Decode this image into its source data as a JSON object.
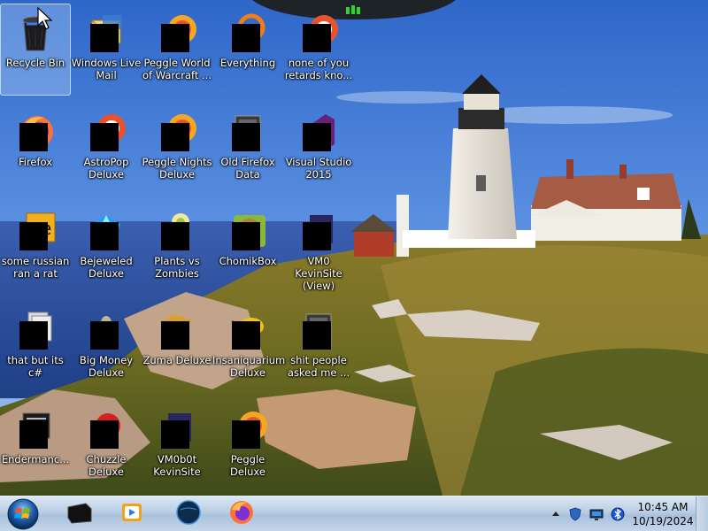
{
  "desktop": {
    "icons": [
      {
        "label": "Recycle Bin",
        "icon": "recycle-bin-icon",
        "redacted": false,
        "selected": true
      },
      {
        "label": "Windows Live Mail",
        "icon": "mail-icon",
        "redacted": true
      },
      {
        "label": "Peggle World of Warcraft ...",
        "icon": "peggle-icon",
        "redacted": true
      },
      {
        "label": "Everything",
        "icon": "search-icon",
        "redacted": true
      },
      {
        "label": "none of you retards kno...",
        "icon": "game-icon",
        "redacted": true
      },
      {
        "label": "Firefox",
        "icon": "firefox-icon",
        "redacted": true
      },
      {
        "label": "AstroPop Deluxe",
        "icon": "game-icon",
        "redacted": true
      },
      {
        "label": "Peggle Nights Deluxe",
        "icon": "peggle-icon",
        "redacted": true
      },
      {
        "label": "Old Firefox Data",
        "icon": "folder-icon",
        "redacted": true
      },
      {
        "label": "Visual Studio 2015",
        "icon": "visual-studio-icon",
        "redacted": true
      },
      {
        "label": "some russian ran a rat",
        "icon": "file-icon",
        "redacted": true
      },
      {
        "label": "Bejeweled Deluxe",
        "icon": "gem-icon",
        "redacted": true
      },
      {
        "label": "Plants vs Zombies",
        "icon": "plant-icon",
        "redacted": true
      },
      {
        "label": "ChomikBox",
        "icon": "hamster-icon",
        "redacted": true
      },
      {
        "label": "VM0 KevinSite (View)",
        "icon": "shortcut-icon",
        "redacted": true
      },
      {
        "label": "that but its c#",
        "icon": "document-icon",
        "redacted": true
      },
      {
        "label": "Big Money Deluxe",
        "icon": "money-icon",
        "redacted": true
      },
      {
        "label": "Zuma Deluxe",
        "icon": "frog-icon",
        "redacted": true
      },
      {
        "label": "Insaniquarium Deluxe",
        "icon": "fish-icon",
        "redacted": true
      },
      {
        "label": "shit people asked me ...",
        "icon": "folder-icon",
        "redacted": true
      },
      {
        "label": "Endermanc...",
        "icon": "terminal-icon",
        "redacted": true
      },
      {
        "label": "Chuzzle Deluxe",
        "icon": "chuzzle-icon",
        "redacted": true
      },
      {
        "label": "VM0b0t KevinSite",
        "icon": "shortcut-icon",
        "redacted": true
      },
      {
        "label": "Peggle Deluxe",
        "icon": "peggle-icon",
        "redacted": true
      }
    ]
  },
  "taskbar": {
    "start": {
      "icon": "windows-start-icon"
    },
    "pinned": [
      {
        "icon": "black-box-icon",
        "name": "pinned-app-1"
      },
      {
        "icon": "media-player-icon",
        "name": "pinned-app-2"
      },
      {
        "icon": "globe-icon",
        "name": "pinned-app-3"
      },
      {
        "icon": "firefox-icon",
        "name": "pinned-app-4"
      }
    ],
    "tray": {
      "icons": [
        "show-hidden-icons-arrow",
        "shield-icon",
        "network-icon",
        "bluetooth-icon"
      ],
      "time": "10:45 AM",
      "date": "10/19/2024"
    }
  },
  "colors": {
    "taskbar_top": "#dbe8f5",
    "taskbar_bottom": "#a9c1dc",
    "selection": "#bedcff"
  }
}
